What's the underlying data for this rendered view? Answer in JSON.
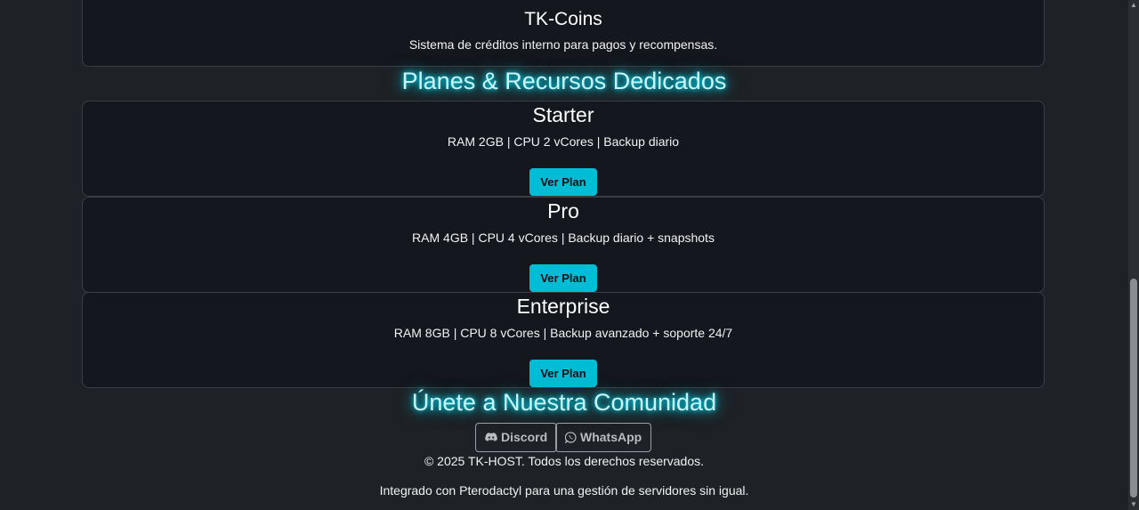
{
  "features": {
    "tkcoins": {
      "title": "TK-Coins",
      "description": "Sistema de créditos interno para pagos y recompensas."
    }
  },
  "plans_section": {
    "title": "Planes & Recursos Dedicados",
    "plans": [
      {
        "name": "Starter",
        "specs": "RAM 2GB | CPU 2 vCores | Backup diario",
        "button_label": "Ver Plan"
      },
      {
        "name": "Pro",
        "specs": "RAM 4GB | CPU 4 vCores | Backup diario + snapshots",
        "button_label": "Ver Plan"
      },
      {
        "name": "Enterprise",
        "specs": "RAM 8GB | CPU 8 vCores | Backup avanzado + soporte 24/7",
        "button_label": "Ver Plan"
      }
    ]
  },
  "community": {
    "title": "Únete a Nuestra Comunidad",
    "discord_label": "Discord",
    "whatsapp_label": "WhatsApp"
  },
  "footer": {
    "copyright": "© 2025 TK-HOST. Todos los derechos reservados.",
    "tagline": "Integrado con Pterodactyl para una gestión de servidores sin igual."
  },
  "colors": {
    "background": "#1e2125",
    "card_background": "#14171d",
    "accent": "#00bcd4",
    "glow_title": "#c9f6fb"
  },
  "icons": {
    "discord": "discord-icon",
    "whatsapp": "whatsapp-icon"
  }
}
